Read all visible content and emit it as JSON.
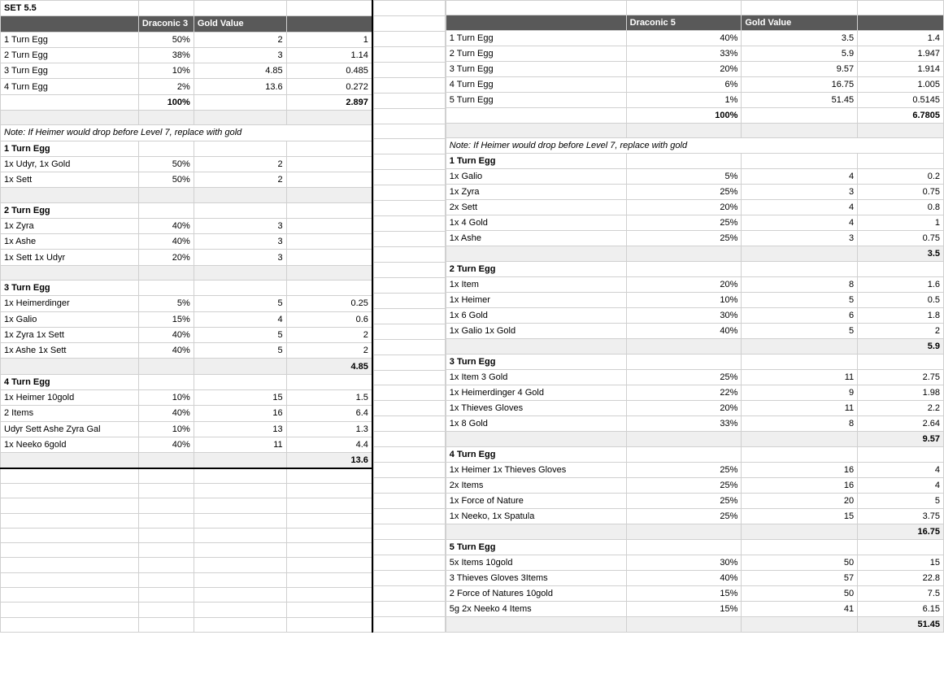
{
  "title": "SET 5.5",
  "left": {
    "hdr2": "Draconic 3",
    "hdr3": "Gold Value",
    "summary": [
      {
        "a": "1 Turn Egg",
        "b": "50%",
        "c": "2",
        "d": "1"
      },
      {
        "a": "2 Turn Egg",
        "b": "38%",
        "c": "3",
        "d": "1.14"
      },
      {
        "a": "3 Turn Egg",
        "b": "10%",
        "c": "4.85",
        "d": "0.485"
      },
      {
        "a": "4 Turn Egg",
        "b": "2%",
        "c": "13.6",
        "d": "0.272"
      }
    ],
    "totalPct": "100%",
    "totalVal": "2.897",
    "note": "Note: If Heimer would drop before Level 7, replace with gold",
    "t1": {
      "title": "1 Turn Egg",
      "rows": [
        {
          "a": "1x Udyr, 1x Gold",
          "b": "50%",
          "c": "2",
          "d": ""
        },
        {
          "a": "1x Sett",
          "b": "50%",
          "c": "2",
          "d": ""
        }
      ]
    },
    "t2": {
      "title": "2 Turn Egg",
      "rows": [
        {
          "a": "1x Zyra",
          "b": "40%",
          "c": "3",
          "d": ""
        },
        {
          "a": "1x Ashe",
          "b": "40%",
          "c": "3",
          "d": ""
        },
        {
          "a": "1x Sett 1x Udyr",
          "b": "20%",
          "c": "3",
          "d": ""
        }
      ]
    },
    "t3": {
      "title": "3 Turn Egg",
      "rows": [
        {
          "a": "1x Heimerdinger",
          "b": "5%",
          "c": "5",
          "d": "0.25"
        },
        {
          "a": "1x Galio",
          "b": "15%",
          "c": "4",
          "d": "0.6"
        },
        {
          "a": "1x Zyra 1x Sett",
          "b": "40%",
          "c": "5",
          "d": "2"
        },
        {
          "a": "1x Ashe 1x Sett",
          "b": "40%",
          "c": "5",
          "d": "2"
        }
      ],
      "total": "4.85"
    },
    "t4": {
      "title": "4 Turn Egg",
      "rows": [
        {
          "a": "1x Heimer 10gold",
          "b": "10%",
          "c": "15",
          "d": "1.5"
        },
        {
          "a": "2 Items",
          "b": "40%",
          "c": "16",
          "d": "6.4"
        },
        {
          "a": "Udyr Sett Ashe Zyra Gal",
          "b": "10%",
          "c": "13",
          "d": "1.3"
        },
        {
          "a": "1x Neeko 6gold",
          "b": "40%",
          "c": "11",
          "d": "4.4"
        }
      ],
      "total": "13.6"
    }
  },
  "right": {
    "hdr2": "Draconic 5",
    "hdr3": "Gold Value",
    "summary": [
      {
        "a": "1 Turn Egg",
        "b": "40%",
        "c": "3.5",
        "d": "1.4"
      },
      {
        "a": "2 Turn Egg",
        "b": "33%",
        "c": "5.9",
        "d": "1.947"
      },
      {
        "a": "3 Turn Egg",
        "b": "20%",
        "c": "9.57",
        "d": "1.914"
      },
      {
        "a": "4 Turn Egg",
        "b": "6%",
        "c": "16.75",
        "d": "1.005"
      },
      {
        "a": "5 Turn Egg",
        "b": "1%",
        "c": "51.45",
        "d": "0.5145"
      }
    ],
    "totalPct": "100%",
    "totalVal": "6.7805",
    "note": "Note: If Heimer would drop before Level 7, replace with gold",
    "t1": {
      "title": "1 Turn Egg",
      "rows": [
        {
          "a": "1x Galio",
          "b": "5%",
          "c": "4",
          "d": "0.2"
        },
        {
          "a": "1x Zyra",
          "b": "25%",
          "c": "3",
          "d": "0.75"
        },
        {
          "a": "2x Sett",
          "b": "20%",
          "c": "4",
          "d": "0.8"
        },
        {
          "a": "1x 4 Gold",
          "b": "25%",
          "c": "4",
          "d": "1"
        },
        {
          "a": "1x Ashe",
          "b": "25%",
          "c": "3",
          "d": "0.75"
        }
      ],
      "total": "3.5"
    },
    "t2": {
      "title": "2 Turn Egg",
      "rows": [
        {
          "a": "1x Item",
          "b": "20%",
          "c": "8",
          "d": "1.6"
        },
        {
          "a": "1x Heimer",
          "b": "10%",
          "c": "5",
          "d": "0.5"
        },
        {
          "a": "1x 6 Gold",
          "b": "30%",
          "c": "6",
          "d": "1.8"
        },
        {
          "a": "1x Galio 1x Gold",
          "b": "40%",
          "c": "5",
          "d": "2"
        }
      ],
      "total": "5.9"
    },
    "t3": {
      "title": "3 Turn Egg",
      "rows": [
        {
          "a": "1x Item 3 Gold",
          "b": "25%",
          "c": "11",
          "d": "2.75"
        },
        {
          "a": "1x Heimerdinger 4 Gold",
          "b": "22%",
          "c": "9",
          "d": "1.98"
        },
        {
          "a": "1x Thieves Gloves",
          "b": "20%",
          "c": "11",
          "d": "2.2"
        },
        {
          "a": "1x 8 Gold",
          "b": "33%",
          "c": "8",
          "d": "2.64"
        }
      ],
      "total": "9.57"
    },
    "t4": {
      "title": "4 Turn Egg",
      "rows": [
        {
          "a": "1x Heimer 1x Thieves Gloves",
          "b": "25%",
          "c": "16",
          "d": "4"
        },
        {
          "a": "2x Items",
          "b": "25%",
          "c": "16",
          "d": "4"
        },
        {
          "a": "1x Force of Nature",
          "b": "25%",
          "c": "20",
          "d": "5"
        },
        {
          "a": "1x Neeko, 1x Spatula",
          "b": "25%",
          "c": "15",
          "d": "3.75"
        }
      ],
      "total": "16.75"
    },
    "t5": {
      "title": "5 Turn Egg",
      "rows": [
        {
          "a": "5x Items 10gold",
          "b": "30%",
          "c": "50",
          "d": "15"
        },
        {
          "a": "3 Thieves Gloves 3Items",
          "b": "40%",
          "c": "57",
          "d": "22.8"
        },
        {
          "a": "2 Force of Natures 10gold",
          "b": "15%",
          "c": "50",
          "d": "7.5"
        },
        {
          "a": "5g 2x Neeko 4 Items",
          "b": "15%",
          "c": "41",
          "d": "6.15"
        }
      ],
      "total": "51.45"
    }
  }
}
